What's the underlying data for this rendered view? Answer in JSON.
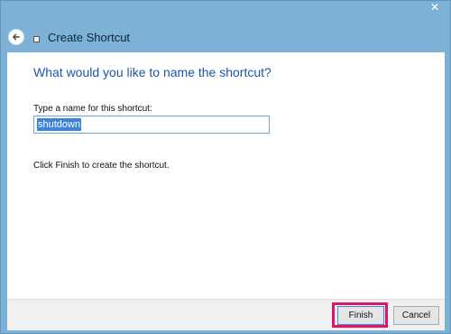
{
  "window": {
    "title": "Create Shortcut",
    "close_glyph": "✕"
  },
  "page": {
    "heading": "What would you like to name the shortcut?",
    "field_label": "Type a name for this shortcut:",
    "name_value": "shutdown",
    "hint": "Click Finish to create the shortcut."
  },
  "footer": {
    "finish_label": "Finish",
    "cancel_label": "Cancel"
  },
  "colors": {
    "highlight": "#e0146a",
    "heading": "#1d55a6",
    "selection": "#3d84d8"
  }
}
